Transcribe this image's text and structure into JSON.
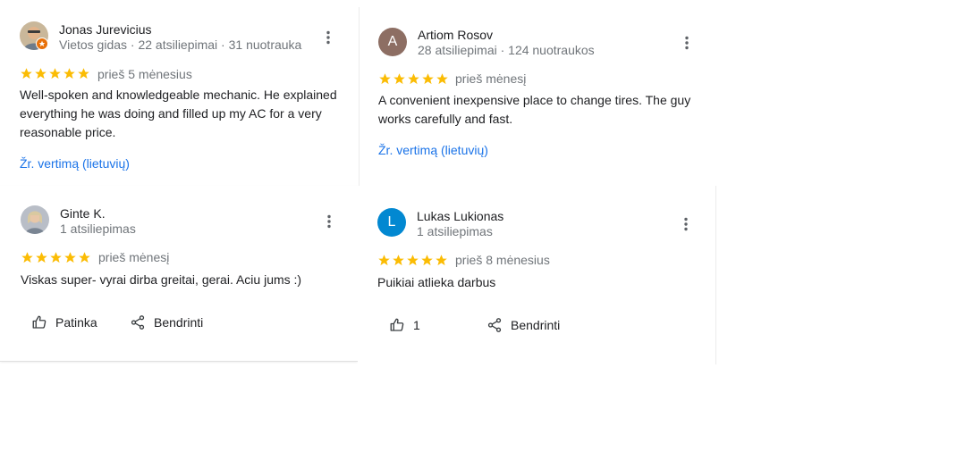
{
  "colors": {
    "star": "#fbbc04",
    "link": "#1a73e8",
    "badge": "#e8710a",
    "avatar_a": "#8d6e63",
    "avatar_l": "#0288d1"
  },
  "reviews": [
    {
      "name": "Jonas Jurevicius",
      "meta": "Vietos gidas · 22 atsiliepimai · 31 nuotrauka",
      "rating": 5,
      "time": "prieš 5 mėnesius",
      "text": "Well-spoken and knowledgeable mechanic. He explained everything he was doing and filled up my AC for a very reasonable price.",
      "translate": "Žr. vertimą (lietuvių)",
      "avatar": "photo",
      "badge_icon": "local-guide-star-icon"
    },
    {
      "name": "Artiom Rosov",
      "meta": "28 atsiliepimai · 124 nuotraukos",
      "rating": 5,
      "time": "prieš mėnesį",
      "text": "A convenient inexpensive place to change tires. The guy works carefully and fast.",
      "translate": "Žr. vertimą (lietuvių)",
      "avatar_letter": "A"
    },
    {
      "name": "Ginte K.",
      "meta": "1 atsiliepimas",
      "rating": 5,
      "time": "prieš mėnesį",
      "text": "Viskas super- vyrai dirba greitai, gerai. Aciu jums :)",
      "like_label": "Patinka",
      "share_label": "Bendrinti",
      "avatar": "photo"
    },
    {
      "name": "Lukas Lukionas",
      "meta": "1 atsiliepimas",
      "rating": 5,
      "time": "prieš 8 mėnesius",
      "text": "Puikiai atlieka darbus",
      "like_count": "1",
      "share_label": "Bendrinti",
      "avatar_letter": "L"
    }
  ]
}
